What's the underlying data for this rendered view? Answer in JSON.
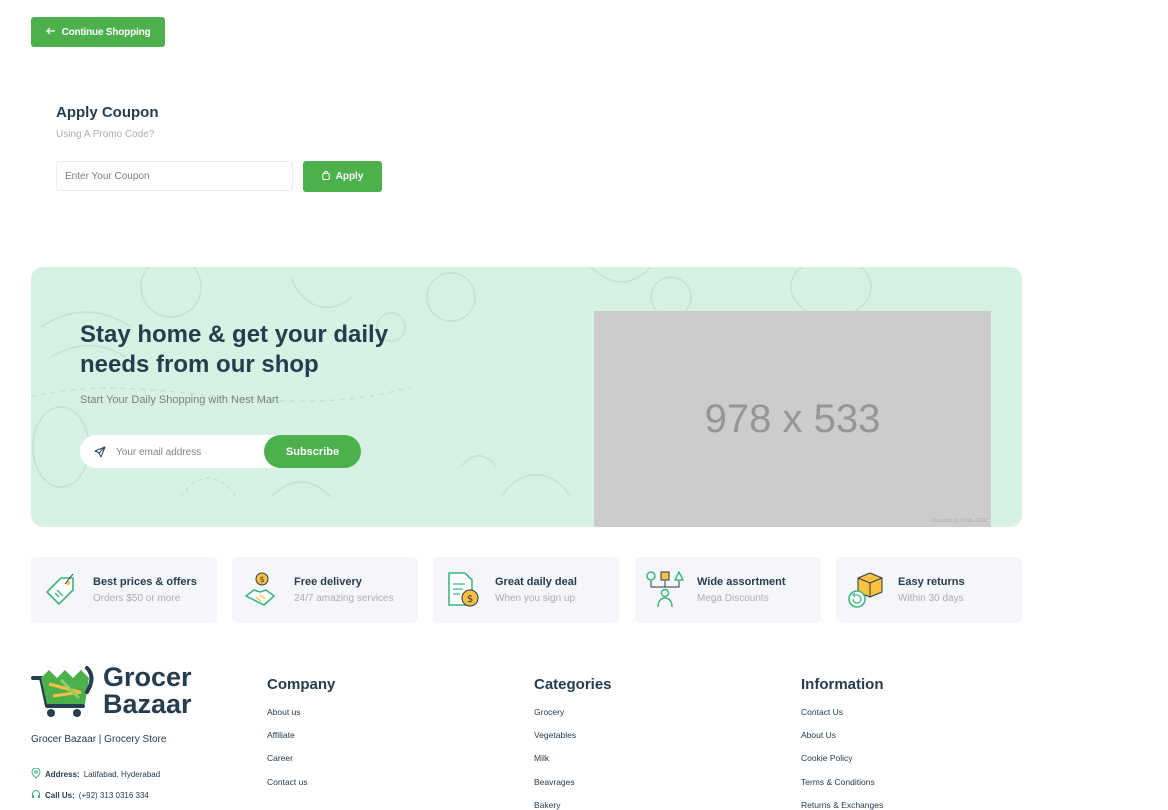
{
  "continue_shopping": {
    "label": "Continue Shopping",
    "icon": "arrow-left-icon"
  },
  "coupon": {
    "title": "Apply Coupon",
    "subtitle": "Using A Promo Code?",
    "placeholder": "Enter Your Coupon",
    "value": "",
    "apply_label": "Apply",
    "apply_icon": "bag-icon"
  },
  "banner": {
    "title": "Stay home & get your daily needs from our shop",
    "subtitle": "Start Your Daily Shopping with Nest Mart",
    "email_placeholder": "Your email address",
    "subscribe_label": "Subscribe",
    "image_text": "978 x 533",
    "powered_text": "Powered by HTML.COM",
    "background_color": "#d8f1e5"
  },
  "features": [
    {
      "title": "Best prices & offers",
      "subtitle": "Orders $50 or more",
      "icon": "price-tag-icon"
    },
    {
      "title": "Free delivery",
      "subtitle": "24/7 amazing services",
      "icon": "handshake-coin-icon"
    },
    {
      "title": "Great daily deal",
      "subtitle": "When you sign up",
      "icon": "invoice-dollar-icon"
    },
    {
      "title": "Wide assortment",
      "subtitle": "Mega Discounts",
      "icon": "assortment-icon"
    },
    {
      "title": "Easy returns",
      "subtitle": "Within 30 days",
      "icon": "return-box-icon"
    }
  ],
  "footer": {
    "logo_line1": "Grocer",
    "logo_line2": "Bazaar",
    "tagline": "Grocer Bazaar | Grocery Store",
    "address_label": "Address:",
    "address_value": "Latifabad, Hyderabad",
    "call_label": "Call Us:",
    "call_value": "(+92) 313 0316 334",
    "columns": [
      {
        "title": "Company",
        "links": [
          "About us",
          "Affiliate",
          "Career",
          "Contact us"
        ]
      },
      {
        "title": "Categories",
        "links": [
          "Grocery",
          "Vegetables",
          "Milk",
          "Beavrages",
          "Bakery"
        ]
      },
      {
        "title": "Information",
        "links": [
          "Contact Us",
          "About Us",
          "Cookie Policy",
          "Terms & Conditions",
          "Returns & Exchanges"
        ]
      }
    ]
  },
  "colors": {
    "accent": "#4cb04c",
    "heading": "#253d4e",
    "muted": "#adadad"
  }
}
